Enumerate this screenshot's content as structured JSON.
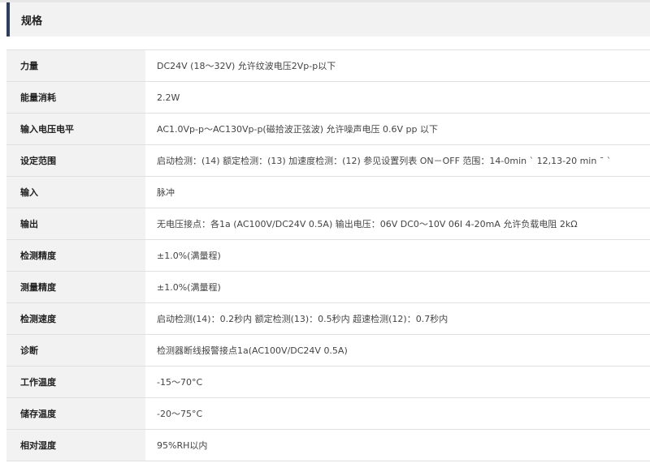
{
  "section": {
    "title": "规格"
  },
  "specs": [
    {
      "label": "力量",
      "value": "DC24V (18～32V) 允许纹波电压2Vp-p以下"
    },
    {
      "label": "能量消耗",
      "value": "2.2W"
    },
    {
      "label": "输入电压电平",
      "value": "AC1.0Vp-p～AC130Vp-p(磁拾波正弦波) 允许噪声电压 0.6V pp 以下"
    },
    {
      "label": "设定范围",
      "value": "启动检测：(14) 额定检测：(13) 加速度检测：(12) 参见设置列表 ON－OFF 范围：14-0min ˋ 12,13-20 min ¯ ˋ"
    },
    {
      "label": "输入",
      "value": "脉冲"
    },
    {
      "label": "输出",
      "value": "无电压接点：各1a (AC100V/DC24V 0.5A) 输出电压：06V DC0～10V 06I 4-20mA 允许负载电阻 2kΩ"
    },
    {
      "label": "检测精度",
      "value": "±1.0%(满量程)"
    },
    {
      "label": "测量精度",
      "value": "±1.0%(满量程)"
    },
    {
      "label": "检测速度",
      "value": "启动检测(14)：0.2秒内 额定检测(13)：0.5秒内 超速检测(12)：0.7秒内"
    },
    {
      "label": "诊断",
      "value": "检测器断线报警接点1a(AC100V/DC24V 0.5A)"
    },
    {
      "label": "工作温度",
      "value": "-15～70°C"
    },
    {
      "label": "储存温度",
      "value": "-20～75°C"
    },
    {
      "label": "相对湿度",
      "value": "95%RH以内"
    }
  ]
}
